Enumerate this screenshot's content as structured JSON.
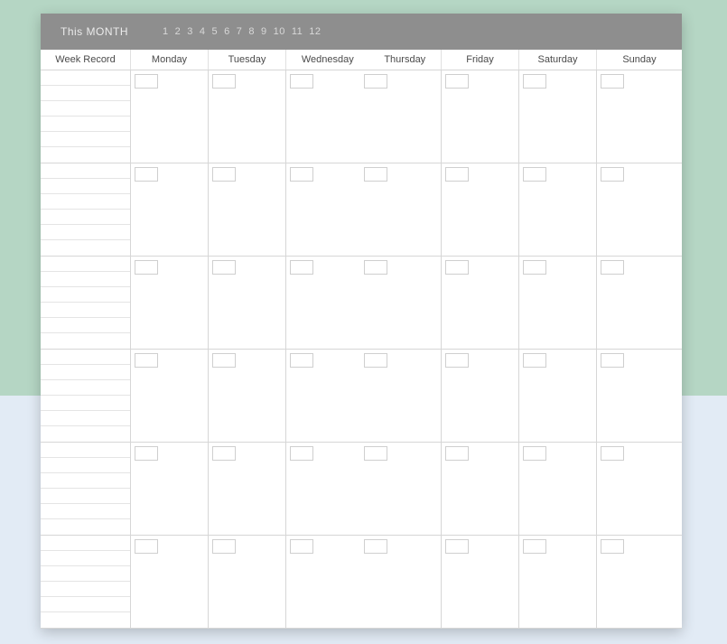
{
  "header": {
    "label": "This MONTH",
    "months": [
      "1",
      "2",
      "3",
      "4",
      "5",
      "6",
      "7",
      "8",
      "9",
      "10",
      "11",
      "12"
    ]
  },
  "columns": {
    "week_record": "Week Record",
    "monday": "Monday",
    "tuesday": "Tuesday",
    "wednesday": "Wednesday",
    "thursday": "Thursday",
    "friday": "Friday",
    "saturday": "Saturday",
    "sunday": "Sunday"
  }
}
